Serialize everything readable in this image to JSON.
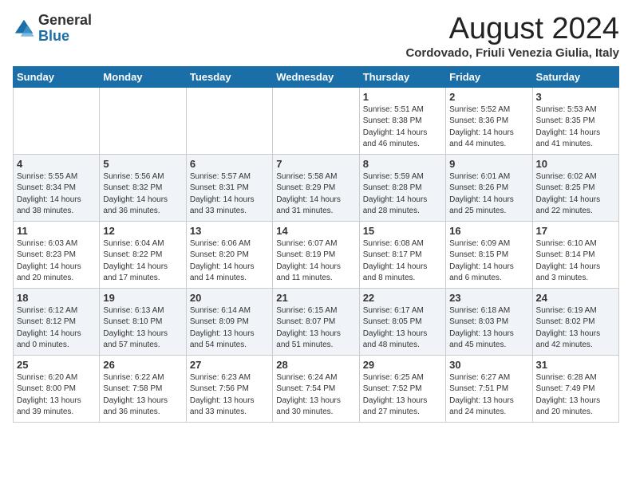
{
  "header": {
    "logo_general": "General",
    "logo_blue": "Blue",
    "main_title": "August 2024",
    "subtitle": "Cordovado, Friuli Venezia Giulia, Italy"
  },
  "days_of_week": [
    "Sunday",
    "Monday",
    "Tuesday",
    "Wednesday",
    "Thursday",
    "Friday",
    "Saturday"
  ],
  "weeks": [
    [
      {
        "day": "",
        "info": ""
      },
      {
        "day": "",
        "info": ""
      },
      {
        "day": "",
        "info": ""
      },
      {
        "day": "",
        "info": ""
      },
      {
        "day": "1",
        "info": "Sunrise: 5:51 AM\nSunset: 8:38 PM\nDaylight: 14 hours\nand 46 minutes."
      },
      {
        "day": "2",
        "info": "Sunrise: 5:52 AM\nSunset: 8:36 PM\nDaylight: 14 hours\nand 44 minutes."
      },
      {
        "day": "3",
        "info": "Sunrise: 5:53 AM\nSunset: 8:35 PM\nDaylight: 14 hours\nand 41 minutes."
      }
    ],
    [
      {
        "day": "4",
        "info": "Sunrise: 5:55 AM\nSunset: 8:34 PM\nDaylight: 14 hours\nand 38 minutes."
      },
      {
        "day": "5",
        "info": "Sunrise: 5:56 AM\nSunset: 8:32 PM\nDaylight: 14 hours\nand 36 minutes."
      },
      {
        "day": "6",
        "info": "Sunrise: 5:57 AM\nSunset: 8:31 PM\nDaylight: 14 hours\nand 33 minutes."
      },
      {
        "day": "7",
        "info": "Sunrise: 5:58 AM\nSunset: 8:29 PM\nDaylight: 14 hours\nand 31 minutes."
      },
      {
        "day": "8",
        "info": "Sunrise: 5:59 AM\nSunset: 8:28 PM\nDaylight: 14 hours\nand 28 minutes."
      },
      {
        "day": "9",
        "info": "Sunrise: 6:01 AM\nSunset: 8:26 PM\nDaylight: 14 hours\nand 25 minutes."
      },
      {
        "day": "10",
        "info": "Sunrise: 6:02 AM\nSunset: 8:25 PM\nDaylight: 14 hours\nand 22 minutes."
      }
    ],
    [
      {
        "day": "11",
        "info": "Sunrise: 6:03 AM\nSunset: 8:23 PM\nDaylight: 14 hours\nand 20 minutes."
      },
      {
        "day": "12",
        "info": "Sunrise: 6:04 AM\nSunset: 8:22 PM\nDaylight: 14 hours\nand 17 minutes."
      },
      {
        "day": "13",
        "info": "Sunrise: 6:06 AM\nSunset: 8:20 PM\nDaylight: 14 hours\nand 14 minutes."
      },
      {
        "day": "14",
        "info": "Sunrise: 6:07 AM\nSunset: 8:19 PM\nDaylight: 14 hours\nand 11 minutes."
      },
      {
        "day": "15",
        "info": "Sunrise: 6:08 AM\nSunset: 8:17 PM\nDaylight: 14 hours\nand 8 minutes."
      },
      {
        "day": "16",
        "info": "Sunrise: 6:09 AM\nSunset: 8:15 PM\nDaylight: 14 hours\nand 6 minutes."
      },
      {
        "day": "17",
        "info": "Sunrise: 6:10 AM\nSunset: 8:14 PM\nDaylight: 14 hours\nand 3 minutes."
      }
    ],
    [
      {
        "day": "18",
        "info": "Sunrise: 6:12 AM\nSunset: 8:12 PM\nDaylight: 14 hours\nand 0 minutes."
      },
      {
        "day": "19",
        "info": "Sunrise: 6:13 AM\nSunset: 8:10 PM\nDaylight: 13 hours\nand 57 minutes."
      },
      {
        "day": "20",
        "info": "Sunrise: 6:14 AM\nSunset: 8:09 PM\nDaylight: 13 hours\nand 54 minutes."
      },
      {
        "day": "21",
        "info": "Sunrise: 6:15 AM\nSunset: 8:07 PM\nDaylight: 13 hours\nand 51 minutes."
      },
      {
        "day": "22",
        "info": "Sunrise: 6:17 AM\nSunset: 8:05 PM\nDaylight: 13 hours\nand 48 minutes."
      },
      {
        "day": "23",
        "info": "Sunrise: 6:18 AM\nSunset: 8:03 PM\nDaylight: 13 hours\nand 45 minutes."
      },
      {
        "day": "24",
        "info": "Sunrise: 6:19 AM\nSunset: 8:02 PM\nDaylight: 13 hours\nand 42 minutes."
      }
    ],
    [
      {
        "day": "25",
        "info": "Sunrise: 6:20 AM\nSunset: 8:00 PM\nDaylight: 13 hours\nand 39 minutes."
      },
      {
        "day": "26",
        "info": "Sunrise: 6:22 AM\nSunset: 7:58 PM\nDaylight: 13 hours\nand 36 minutes."
      },
      {
        "day": "27",
        "info": "Sunrise: 6:23 AM\nSunset: 7:56 PM\nDaylight: 13 hours\nand 33 minutes."
      },
      {
        "day": "28",
        "info": "Sunrise: 6:24 AM\nSunset: 7:54 PM\nDaylight: 13 hours\nand 30 minutes."
      },
      {
        "day": "29",
        "info": "Sunrise: 6:25 AM\nSunset: 7:52 PM\nDaylight: 13 hours\nand 27 minutes."
      },
      {
        "day": "30",
        "info": "Sunrise: 6:27 AM\nSunset: 7:51 PM\nDaylight: 13 hours\nand 24 minutes."
      },
      {
        "day": "31",
        "info": "Sunrise: 6:28 AM\nSunset: 7:49 PM\nDaylight: 13 hours\nand 20 minutes."
      }
    ]
  ]
}
